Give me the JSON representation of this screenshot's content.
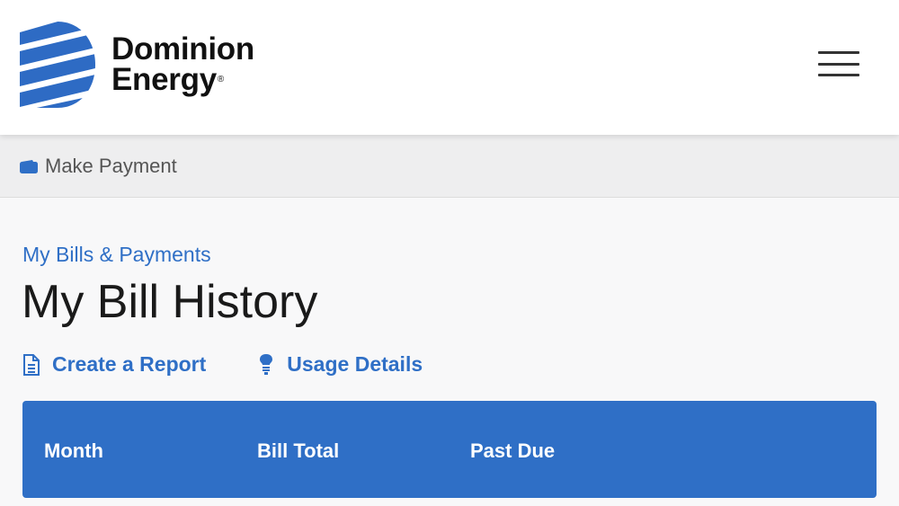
{
  "header": {
    "logo_line1": "Dominion",
    "logo_line2": "Energy",
    "logo_reg": "®",
    "menu_icon": "hamburger-menu-icon"
  },
  "action_bar": {
    "make_payment_label": "Make Payment",
    "make_payment_icon": "wallet-icon"
  },
  "main": {
    "breadcrumb": "My Bills & Payments",
    "title": "My Bill History",
    "links": [
      {
        "label": "Create a Report",
        "icon": "document-icon"
      },
      {
        "label": "Usage Details",
        "icon": "lightbulb-icon"
      }
    ],
    "table": {
      "columns": [
        "Month",
        "Bill Total",
        "Past Due"
      ]
    }
  },
  "colors": {
    "brand_blue": "#2f6fc6",
    "logo_blue": "#2e6bc4",
    "text_dark": "#1a1a1a"
  }
}
